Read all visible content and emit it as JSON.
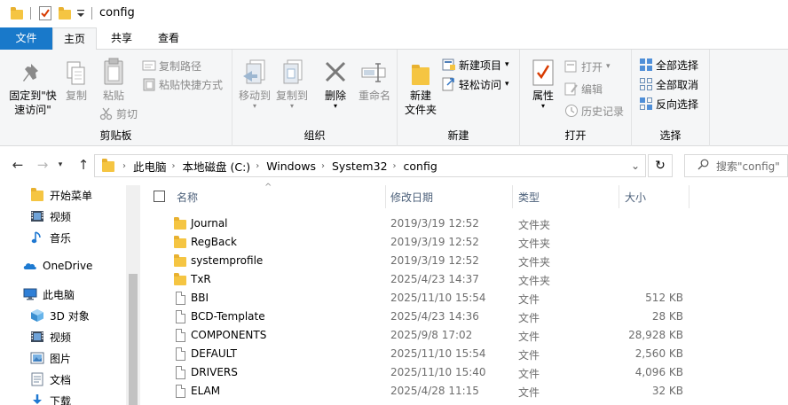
{
  "window": {
    "title": "config"
  },
  "tabs": {
    "file": "文件",
    "home": "主页",
    "share": "共享",
    "view": "查看"
  },
  "ribbon": {
    "clipboard": {
      "label": "剪贴板",
      "pin_line1": "固定到\"快",
      "pin_line2": "速访问\"",
      "copy": "复制",
      "paste": "粘贴",
      "copy_path": "复制路径",
      "paste_shortcut": "粘贴快捷方式",
      "cut": "剪切"
    },
    "organize": {
      "label": "组织",
      "move_to": "移动到",
      "copy_to": "复制到",
      "delete": "删除",
      "rename": "重命名"
    },
    "new": {
      "label": "新建",
      "new_folder_line1": "新建",
      "new_folder_line2": "文件夹",
      "new_item": "新建项目",
      "easy_access": "轻松访问"
    },
    "open": {
      "label": "打开",
      "properties": "属性",
      "open": "打开",
      "edit": "编辑",
      "history": "历史记录"
    },
    "select": {
      "label": "选择",
      "select_all": "全部选择",
      "select_none": "全部取消",
      "invert": "反向选择"
    }
  },
  "address": {
    "crumbs": [
      "此电脑",
      "本地磁盘 (C:)",
      "Windows",
      "System32",
      "config"
    ]
  },
  "search": {
    "placeholder": "搜索\"config\""
  },
  "nav": {
    "items": [
      {
        "label": "开始菜单",
        "icon": "folder-icon"
      },
      {
        "label": "视频",
        "icon": "video-icon"
      },
      {
        "label": "音乐",
        "icon": "music-icon"
      },
      {
        "label": "OneDrive",
        "icon": "onedrive-icon"
      },
      {
        "label": "此电脑",
        "icon": "pc-icon"
      },
      {
        "label": "3D 对象",
        "icon": "3d-icon"
      },
      {
        "label": "视频",
        "icon": "video-icon"
      },
      {
        "label": "图片",
        "icon": "pictures-icon"
      },
      {
        "label": "文档",
        "icon": "documents-icon"
      },
      {
        "label": "下载",
        "icon": "download-icon"
      }
    ]
  },
  "columns": {
    "name": "名称",
    "date": "修改日期",
    "type": "类型",
    "size": "大小"
  },
  "files": [
    {
      "name": "Journal",
      "date": "2019/3/19 12:52",
      "type": "文件夹",
      "size": "",
      "kind": "folder"
    },
    {
      "name": "RegBack",
      "date": "2019/3/19 12:52",
      "type": "文件夹",
      "size": "",
      "kind": "folder"
    },
    {
      "name": "systemprofile",
      "date": "2019/3/19 12:52",
      "type": "文件夹",
      "size": "",
      "kind": "folder"
    },
    {
      "name": "TxR",
      "date": "2025/4/23 14:37",
      "type": "文件夹",
      "size": "",
      "kind": "folder"
    },
    {
      "name": "BBI",
      "date": "2025/11/10 15:54",
      "type": "文件",
      "size": "512 KB",
      "kind": "file"
    },
    {
      "name": "BCD-Template",
      "date": "2025/4/23 14:36",
      "type": "文件",
      "size": "28 KB",
      "kind": "file"
    },
    {
      "name": "COMPONENTS",
      "date": "2025/9/8 17:02",
      "type": "文件",
      "size": "28,928 KB",
      "kind": "file"
    },
    {
      "name": "DEFAULT",
      "date": "2025/11/10 15:54",
      "type": "文件",
      "size": "2,560 KB",
      "kind": "file"
    },
    {
      "name": "DRIVERS",
      "date": "2025/11/10 15:40",
      "type": "文件",
      "size": "4,096 KB",
      "kind": "file"
    },
    {
      "name": "ELAM",
      "date": "2025/4/28 11:15",
      "type": "文件",
      "size": "32 KB",
      "kind": "file"
    }
  ],
  "colors": {
    "accent": "#1979ca",
    "folder": "#f5c542",
    "ribbon_bg": "#f5f6f7"
  }
}
